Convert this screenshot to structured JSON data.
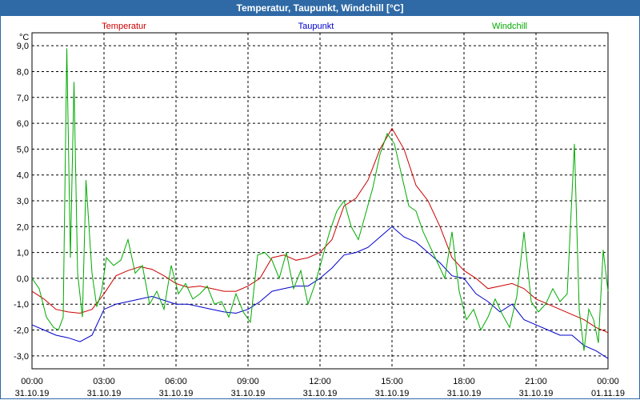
{
  "window": {
    "title": "Temperatur, Taupunkt, Windchill [°C]"
  },
  "chart_data": {
    "type": "line",
    "title": "Temperatur, Taupunkt, Windchill [°C]",
    "ylabel": "°C",
    "ylim": [
      -3.5,
      9.5
    ],
    "xlim": [
      0,
      24
    ],
    "yticks": [
      -3,
      -2,
      -1,
      0,
      1,
      2,
      3,
      4,
      5,
      6,
      7,
      8,
      9
    ],
    "ytick_labels": [
      "-3,0",
      "-2,0",
      "-1,0",
      "0,0",
      "1,0",
      "2,0",
      "3,0",
      "4,0",
      "5,0",
      "6,0",
      "7,0",
      "8,0",
      "9,0"
    ],
    "xticks": [
      0,
      3,
      6,
      9,
      12,
      15,
      18,
      21,
      24
    ],
    "xtick_labels": [
      {
        "time": "00:00",
        "date": "31.10.19"
      },
      {
        "time": "03:00",
        "date": "31.10.19"
      },
      {
        "time": "06:00",
        "date": "31.10.19"
      },
      {
        "time": "09:00",
        "date": "31.10.19"
      },
      {
        "time": "12:00",
        "date": "31.10.19"
      },
      {
        "time": "15:00",
        "date": "31.10.19"
      },
      {
        "time": "18:00",
        "date": "31.10.19"
      },
      {
        "time": "21:00",
        "date": "31.10.19"
      },
      {
        "time": "00:00",
        "date": "01.11.19"
      }
    ],
    "grid": true,
    "legend": "top",
    "series": [
      {
        "name": "Temperatur",
        "color": "#cc0000",
        "x": [
          0,
          0.5,
          1,
          1.5,
          2,
          2.5,
          3,
          3.5,
          4,
          4.5,
          5,
          5.5,
          6,
          6.5,
          7,
          7.5,
          8,
          8.5,
          9,
          9.5,
          10,
          10.5,
          11,
          11.5,
          12,
          12.5,
          13,
          13.5,
          14,
          14.5,
          15,
          15.5,
          16,
          16.5,
          17,
          17.5,
          18,
          18.5,
          19,
          19.5,
          20,
          20.5,
          21,
          21.5,
          22,
          22.5,
          23,
          23.5,
          24
        ],
        "y": [
          -0.5,
          -0.8,
          -1.2,
          -1.3,
          -1.35,
          -1.2,
          -0.6,
          0.1,
          0.3,
          0.45,
          0.35,
          0.1,
          -0.2,
          -0.35,
          -0.3,
          -0.4,
          -0.5,
          -0.5,
          -0.3,
          0.0,
          0.8,
          0.9,
          0.7,
          0.8,
          1.0,
          1.5,
          2.8,
          3.1,
          3.8,
          5.0,
          5.8,
          5.0,
          3.6,
          3.0,
          2.0,
          0.8,
          0.3,
          0.0,
          -0.4,
          -0.3,
          -0.2,
          -0.4,
          -0.8,
          -1.0,
          -1.2,
          -1.4,
          -1.6,
          -1.9,
          -2.1
        ]
      },
      {
        "name": "Taupunkt",
        "color": "#0000cc",
        "x": [
          0,
          0.5,
          1,
          1.5,
          2,
          2.5,
          3,
          3.5,
          4,
          4.5,
          5,
          5.5,
          6,
          6.5,
          7,
          7.5,
          8,
          8.5,
          9,
          9.5,
          10,
          10.5,
          11,
          11.5,
          12,
          12.5,
          13,
          13.5,
          14,
          14.5,
          15,
          15.5,
          16,
          16.5,
          17,
          17.5,
          18,
          18.5,
          19,
          19.5,
          20,
          20.5,
          21,
          21.5,
          22,
          22.5,
          23,
          23.5,
          24
        ],
        "y": [
          -1.8,
          -2.0,
          -2.2,
          -2.3,
          -2.45,
          -2.2,
          -1.2,
          -1.0,
          -0.9,
          -0.8,
          -0.7,
          -0.85,
          -1.0,
          -1.0,
          -1.1,
          -1.2,
          -1.3,
          -1.35,
          -1.2,
          -0.9,
          -0.5,
          -0.4,
          -0.3,
          -0.3,
          0.0,
          0.4,
          0.9,
          1.0,
          1.2,
          1.6,
          2.0,
          1.6,
          1.4,
          1.0,
          0.6,
          0.1,
          0.0,
          -0.6,
          -0.9,
          -1.3,
          -1.0,
          -1.6,
          -1.8,
          -2.0,
          -2.2,
          -2.2,
          -2.6,
          -2.8,
          -3.1
        ]
      },
      {
        "name": "Windchill",
        "color": "#00aa00",
        "x": [
          0,
          0.3,
          0.6,
          0.9,
          1.1,
          1.3,
          1.45,
          1.6,
          1.75,
          1.9,
          2.1,
          2.25,
          2.5,
          2.7,
          2.9,
          3.1,
          3.4,
          3.7,
          4.0,
          4.3,
          4.6,
          4.9,
          5.2,
          5.5,
          5.8,
          6.1,
          6.4,
          6.7,
          7.0,
          7.3,
          7.6,
          7.9,
          8.2,
          8.5,
          8.8,
          9.1,
          9.4,
          9.7,
          10.0,
          10.3,
          10.6,
          10.9,
          11.2,
          11.5,
          11.8,
          12.1,
          12.4,
          12.7,
          13.0,
          13.3,
          13.6,
          13.9,
          14.2,
          14.5,
          14.8,
          15.1,
          15.4,
          15.7,
          16.0,
          16.3,
          16.6,
          16.9,
          17.2,
          17.5,
          17.8,
          18.1,
          18.4,
          18.7,
          19.0,
          19.3,
          19.6,
          19.9,
          20.2,
          20.5,
          20.8,
          21.1,
          21.4,
          21.7,
          22.0,
          22.3,
          22.6,
          22.8,
          23.0,
          23.2,
          23.4,
          23.6,
          23.8,
          24.0
        ],
        "y": [
          0.0,
          -0.4,
          -1.5,
          -1.9,
          -2.0,
          -1.5,
          8.9,
          0.8,
          7.6,
          0.2,
          -1.5,
          3.8,
          0.2,
          -1.1,
          -0.5,
          0.8,
          0.5,
          0.7,
          1.5,
          0.2,
          0.5,
          -1.0,
          -0.5,
          -1.2,
          0.5,
          -0.6,
          -0.2,
          -0.8,
          -0.6,
          -0.3,
          -1.0,
          -0.9,
          -1.5,
          -0.6,
          -1.3,
          -1.7,
          0.9,
          1.0,
          0.7,
          0.0,
          1.0,
          -0.4,
          0.3,
          -1.0,
          -0.2,
          0.8,
          1.8,
          2.6,
          3.0,
          2.0,
          1.5,
          2.5,
          3.5,
          4.8,
          5.6,
          5.2,
          4.0,
          2.8,
          2.6,
          1.8,
          1.2,
          0.6,
          0.0,
          1.8,
          -0.5,
          -1.6,
          -1.2,
          -2.0,
          -1.5,
          -0.8,
          -1.4,
          -1.9,
          -0.7,
          1.8,
          -0.9,
          -1.3,
          -1.0,
          -0.4,
          -0.9,
          -0.6,
          5.2,
          -1.2,
          -2.8,
          -1.2,
          -1.6,
          -2.5,
          1.1,
          -0.5
        ]
      }
    ]
  }
}
